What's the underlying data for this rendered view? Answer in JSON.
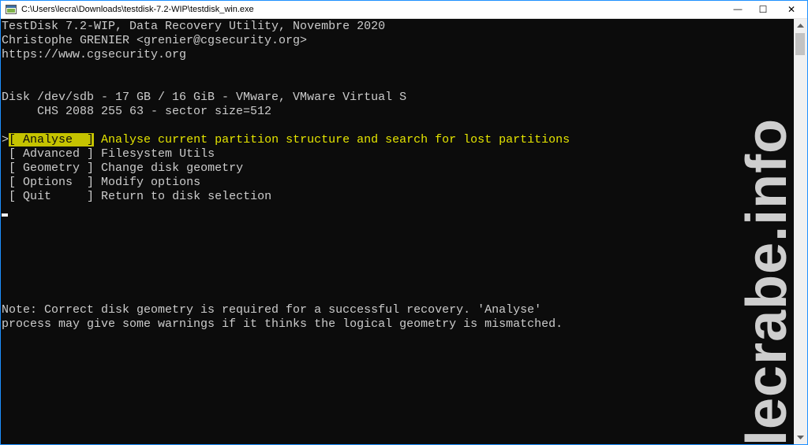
{
  "window": {
    "title": "C:\\Users\\lecra\\Downloads\\testdisk-7.2-WIP\\testdisk_win.exe",
    "minimize_symbol": "—",
    "maximize_symbol": "☐",
    "close_symbol": "✕"
  },
  "header": {
    "line1": "TestDisk 7.2-WIP, Data Recovery Utility, Novembre 2020",
    "line2": "Christophe GRENIER <grenier@cgsecurity.org>",
    "line3": "https://www.cgsecurity.org"
  },
  "disk": {
    "line1": "Disk /dev/sdb - 17 GB / 16 GiB - VMware, VMware Virtual S",
    "line2": "     CHS 2088 255 63 - sector size=512"
  },
  "menu": {
    "items": [
      {
        "prefix": ">",
        "label": "[ Analyse  ]",
        "description": " Analyse current partition structure and search for lost partitions",
        "selected": true
      },
      {
        "prefix": " ",
        "label": "[ Advanced ]",
        "description": " Filesystem Utils",
        "selected": false
      },
      {
        "prefix": " ",
        "label": "[ Geometry ]",
        "description": " Change disk geometry",
        "selected": false
      },
      {
        "prefix": " ",
        "label": "[ Options  ]",
        "description": " Modify options",
        "selected": false
      },
      {
        "prefix": " ",
        "label": "[ Quit     ]",
        "description": " Return to disk selection",
        "selected": false
      }
    ]
  },
  "note": {
    "line1": "Note: Correct disk geometry is required for a successful recovery. 'Analyse'",
    "line2": "process may give some warnings if it thinks the logical geometry is mismatched."
  },
  "watermark": "lecrabe.info",
  "colors": {
    "background": "#0c0c0c",
    "text": "#cccccc",
    "highlight": "#c5c300",
    "highlight_text": "#e5e500"
  }
}
